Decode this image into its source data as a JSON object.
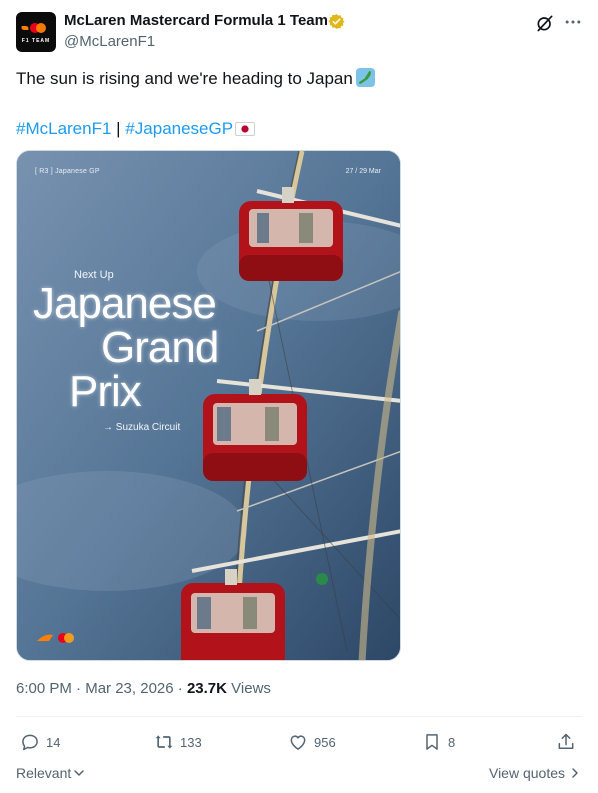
{
  "author": {
    "name": "McLaren Mastercard Formula 1 Team",
    "handle": "@McLarenF1",
    "avatar_text": "F1 TEAM",
    "verified_color": "#e2b719"
  },
  "post": {
    "text": "The sun is rising and we're heading to Japan",
    "text_emoji": "map-of-japan-emoji",
    "hashtag1": "#McLarenF1",
    "separator": "|",
    "hashtag2": "#JapaneseGP",
    "hashtag_emoji": "japan-flag-emoji",
    "link_color": "#1d9bf0"
  },
  "media": {
    "top_left": "[ R3 ] Japanese GP",
    "top_right": "27 / 29 Mar",
    "next_up": "Next Up",
    "title_line1": "Japanese",
    "title_line2": "Grand",
    "title_line3": "Prix",
    "circuit": "→ Suzuka Circuit",
    "accent_red": "#c4161c"
  },
  "meta": {
    "time": "6:00 PM",
    "dot1": "·",
    "date": "Mar 23, 2026",
    "dot2": "·",
    "views_count": "23.7K",
    "views_label": "Views"
  },
  "actions": {
    "replies": "14",
    "reposts": "133",
    "likes": "956",
    "bookmarks": "8"
  },
  "footer": {
    "sort_label": "Relevant",
    "quotes_label": "View quotes"
  }
}
